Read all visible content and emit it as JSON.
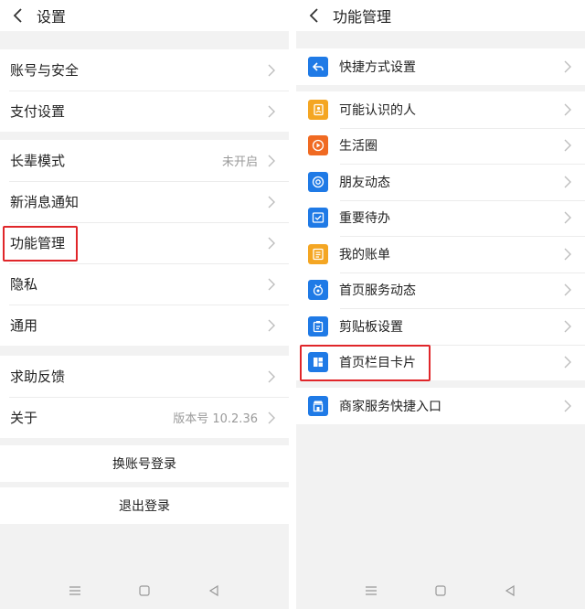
{
  "left": {
    "title": "设置",
    "groups": [
      [
        {
          "label": "账号与安全"
        },
        {
          "label": "支付设置"
        }
      ],
      [
        {
          "label": "长辈模式",
          "value": "未开启"
        },
        {
          "label": "新消息通知"
        },
        {
          "label": "功能管理"
        },
        {
          "label": "隐私"
        },
        {
          "label": "通用"
        }
      ],
      [
        {
          "label": "求助反馈"
        },
        {
          "label": "关于",
          "value": "版本号 10.2.36"
        }
      ]
    ],
    "switch_account": "换账号登录",
    "logout": "退出登录"
  },
  "right": {
    "title": "功能管理",
    "groups": [
      [
        {
          "label": "快捷方式设置",
          "icon": "shortcut-icon",
          "color": "#1f7ae6"
        }
      ],
      [
        {
          "label": "可能认识的人",
          "icon": "contacts-icon",
          "color": "#f4a623"
        },
        {
          "label": "生活圈",
          "icon": "play-icon",
          "color": "#f06a22"
        },
        {
          "label": "朋友动态",
          "icon": "aperture-icon",
          "color": "#1f7ae6"
        },
        {
          "label": "重要待办",
          "icon": "checkbox-icon",
          "color": "#1f7ae6"
        },
        {
          "label": "我的账单",
          "icon": "bill-icon",
          "color": "#f4a623"
        },
        {
          "label": "首页服务动态",
          "icon": "service-icon",
          "color": "#1f7ae6"
        },
        {
          "label": "剪贴板设置",
          "icon": "clipboard-icon",
          "color": "#1f7ae6"
        },
        {
          "label": "首页栏目卡片",
          "icon": "card-layout-icon",
          "color": "#1f7ae6"
        }
      ],
      [
        {
          "label": "商家服务快捷入口",
          "icon": "store-icon",
          "color": "#1f7ae6"
        }
      ]
    ]
  },
  "colors": {
    "highlight": "#e0262a",
    "blue": "#1f7ae6",
    "yellow": "#f4a623",
    "orange": "#f06a22"
  }
}
